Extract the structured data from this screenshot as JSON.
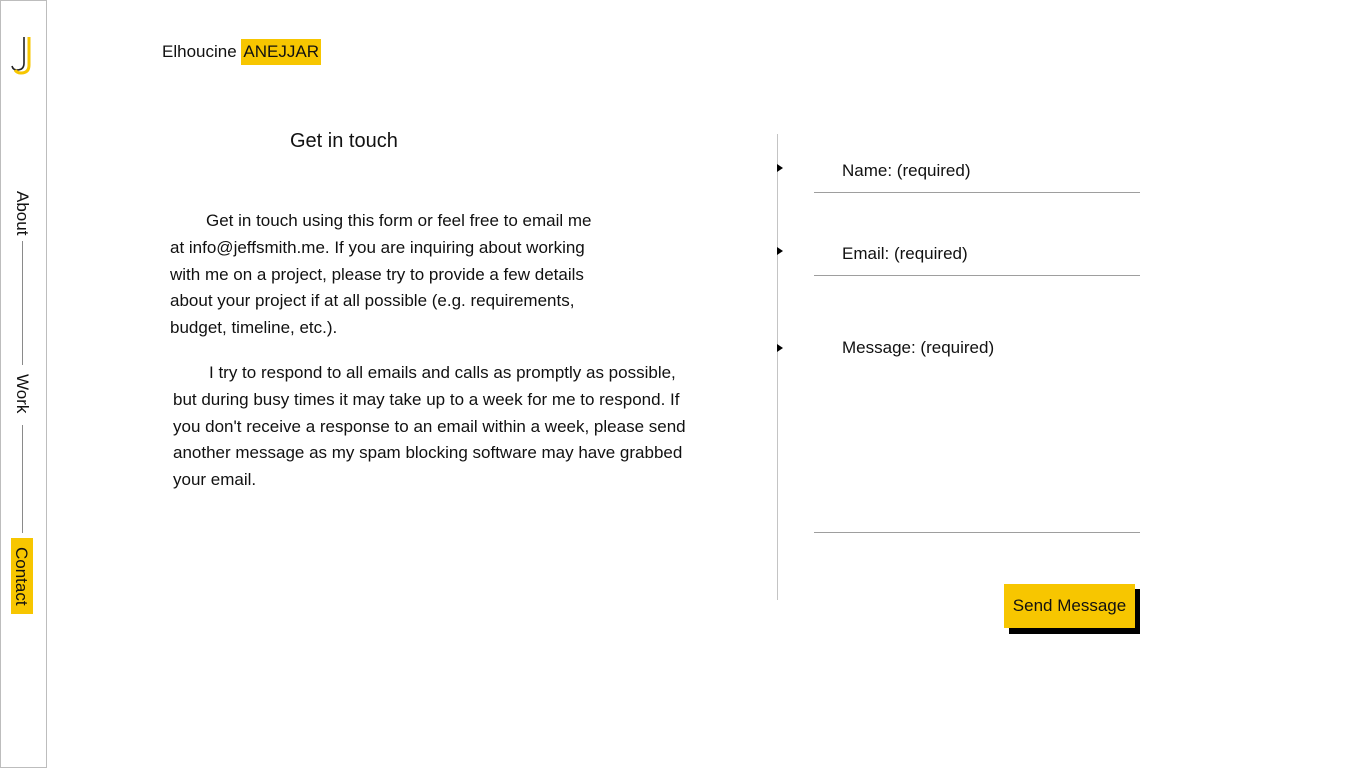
{
  "sidebar": {
    "logo_icon": "j-logo-icon",
    "accent_color": "#f7c600",
    "items": [
      {
        "label": "About",
        "active": false
      },
      {
        "label": "Work",
        "active": false
      },
      {
        "label": "Contact",
        "active": true
      }
    ]
  },
  "header": {
    "first_name": "Elhoucine",
    "last_name": "ANEJJAR"
  },
  "contact": {
    "title": "Get in touch",
    "paragraph_1": "Get in touch using this form or feel free to email me at info@jeffsmith.me. If you are inquiring about working with me on a project, please try to provide a few details about your project if at all possible (e.g. requirements, budget, timeline, etc.).",
    "paragraph_2": "I try to respond to all emails and calls as promptly as possible, but during busy times it may take up to a week for me to respond. If you don't receive a response to an email within a week, please send another message as my spam blocking software may have grabbed your email."
  },
  "form": {
    "name_placeholder": "Name: (required)",
    "email_placeholder": "Email: (required)",
    "message_placeholder": "Message: (required)",
    "submit_label": "Send Message"
  }
}
